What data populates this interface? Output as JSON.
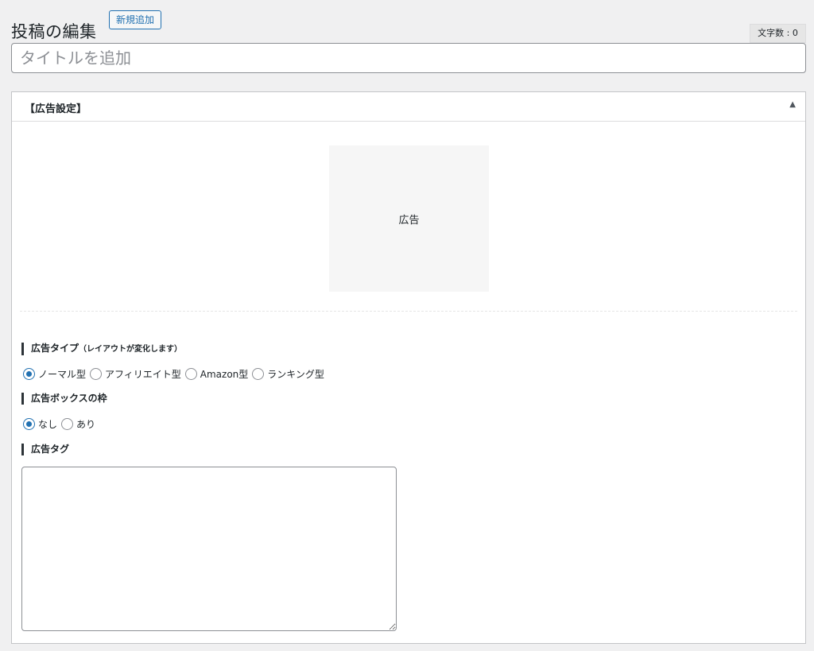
{
  "header": {
    "page_title": "投稿の編集",
    "add_new_label": "新規追加",
    "word_count": "文字数 : 0"
  },
  "title_input": {
    "placeholder": "タイトルを追加",
    "value": ""
  },
  "metabox": {
    "title": "【広告設定】",
    "toggle_icon": "triangle-up-icon",
    "preview_label": "広告",
    "ad_type": {
      "label": "広告タイプ",
      "note": "（レイアウトが変化します）",
      "options": [
        "ノーマル型",
        "アフィリエイト型",
        "Amazon型",
        "ランキング型"
      ],
      "selected": "ノーマル型"
    },
    "box_frame": {
      "label": "広告ボックスの枠",
      "options": [
        "なし",
        "あり"
      ],
      "selected": "なし"
    },
    "ad_tag": {
      "label": "広告タグ",
      "value": ""
    }
  },
  "colors": {
    "accent": "#2271b1",
    "background": "#f0f0f1",
    "panel": "#ffffff"
  }
}
